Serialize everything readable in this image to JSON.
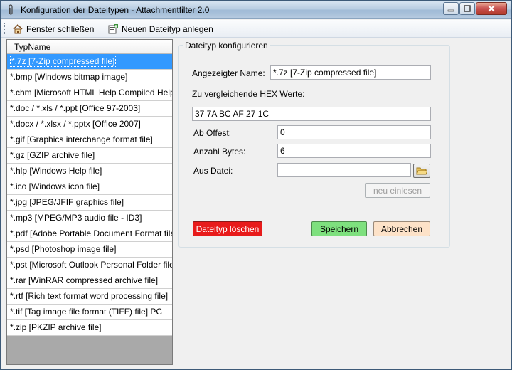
{
  "window": {
    "title": "Konfiguration der Dateitypen - Attachmentfilter 2.0"
  },
  "toolbar": {
    "close_label": "Fenster schließen",
    "new_type_label": "Neuen Dateityp anlegen"
  },
  "list": {
    "header": "TypName",
    "selected_index": 0,
    "items": [
      "*.7z [7-Zip compressed file]",
      "*.bmp [Windows bitmap image]",
      "*.chm [Microsoft HTML Help Compiled Help F…",
      "*.doc / *.xls / *.ppt [Office 97-2003]",
      "*.docx / *.xlsx / *.pptx [Office 2007]",
      "*.gif [Graphics interchange format file]",
      "*.gz [GZIP archive file]",
      "*.hlp [Windows Help file]",
      "*.ico [Windows icon file]",
      "*.jpg [JPEG/JFIF graphics file]",
      "*.mp3 [MPEG/MP3 audio file - ID3]",
      "*.pdf [Adobe Portable Document Format file]",
      "*.psd [Photoshop image file]",
      "*.pst [Microsoft Outlook Personal Folder file]",
      "*.rar [WinRAR compressed archive file]",
      "*.rtf [Rich text format word processing file]",
      "*.tif [Tag image file format (TIFF) file] PC",
      "*.zip [PKZIP archive file]"
    ]
  },
  "config": {
    "group_title": "Dateityp konfigurieren",
    "display_name_label": "Angezeigter Name:",
    "display_name_value": "*.7z [7-Zip compressed file]",
    "hex_label": "Zu vergleichende HEX Werte:",
    "hex_value": "37 7A BC AF 27 1C",
    "offset_label": "Ab Offest:",
    "offset_value": "0",
    "bytes_label": "Anzahl Bytes:",
    "bytes_value": "6",
    "file_label": "Aus Datei:",
    "file_value": "",
    "reload_label": "neu einlesen",
    "delete_label": "Dateityp löschen",
    "save_label": "Speichern",
    "cancel_label": "Abbrechen"
  },
  "colors": {
    "delete_button": "#e81b1b",
    "save_button": "#7ee07e",
    "cancel_button": "#fde2c8",
    "selection": "#3399ff"
  }
}
